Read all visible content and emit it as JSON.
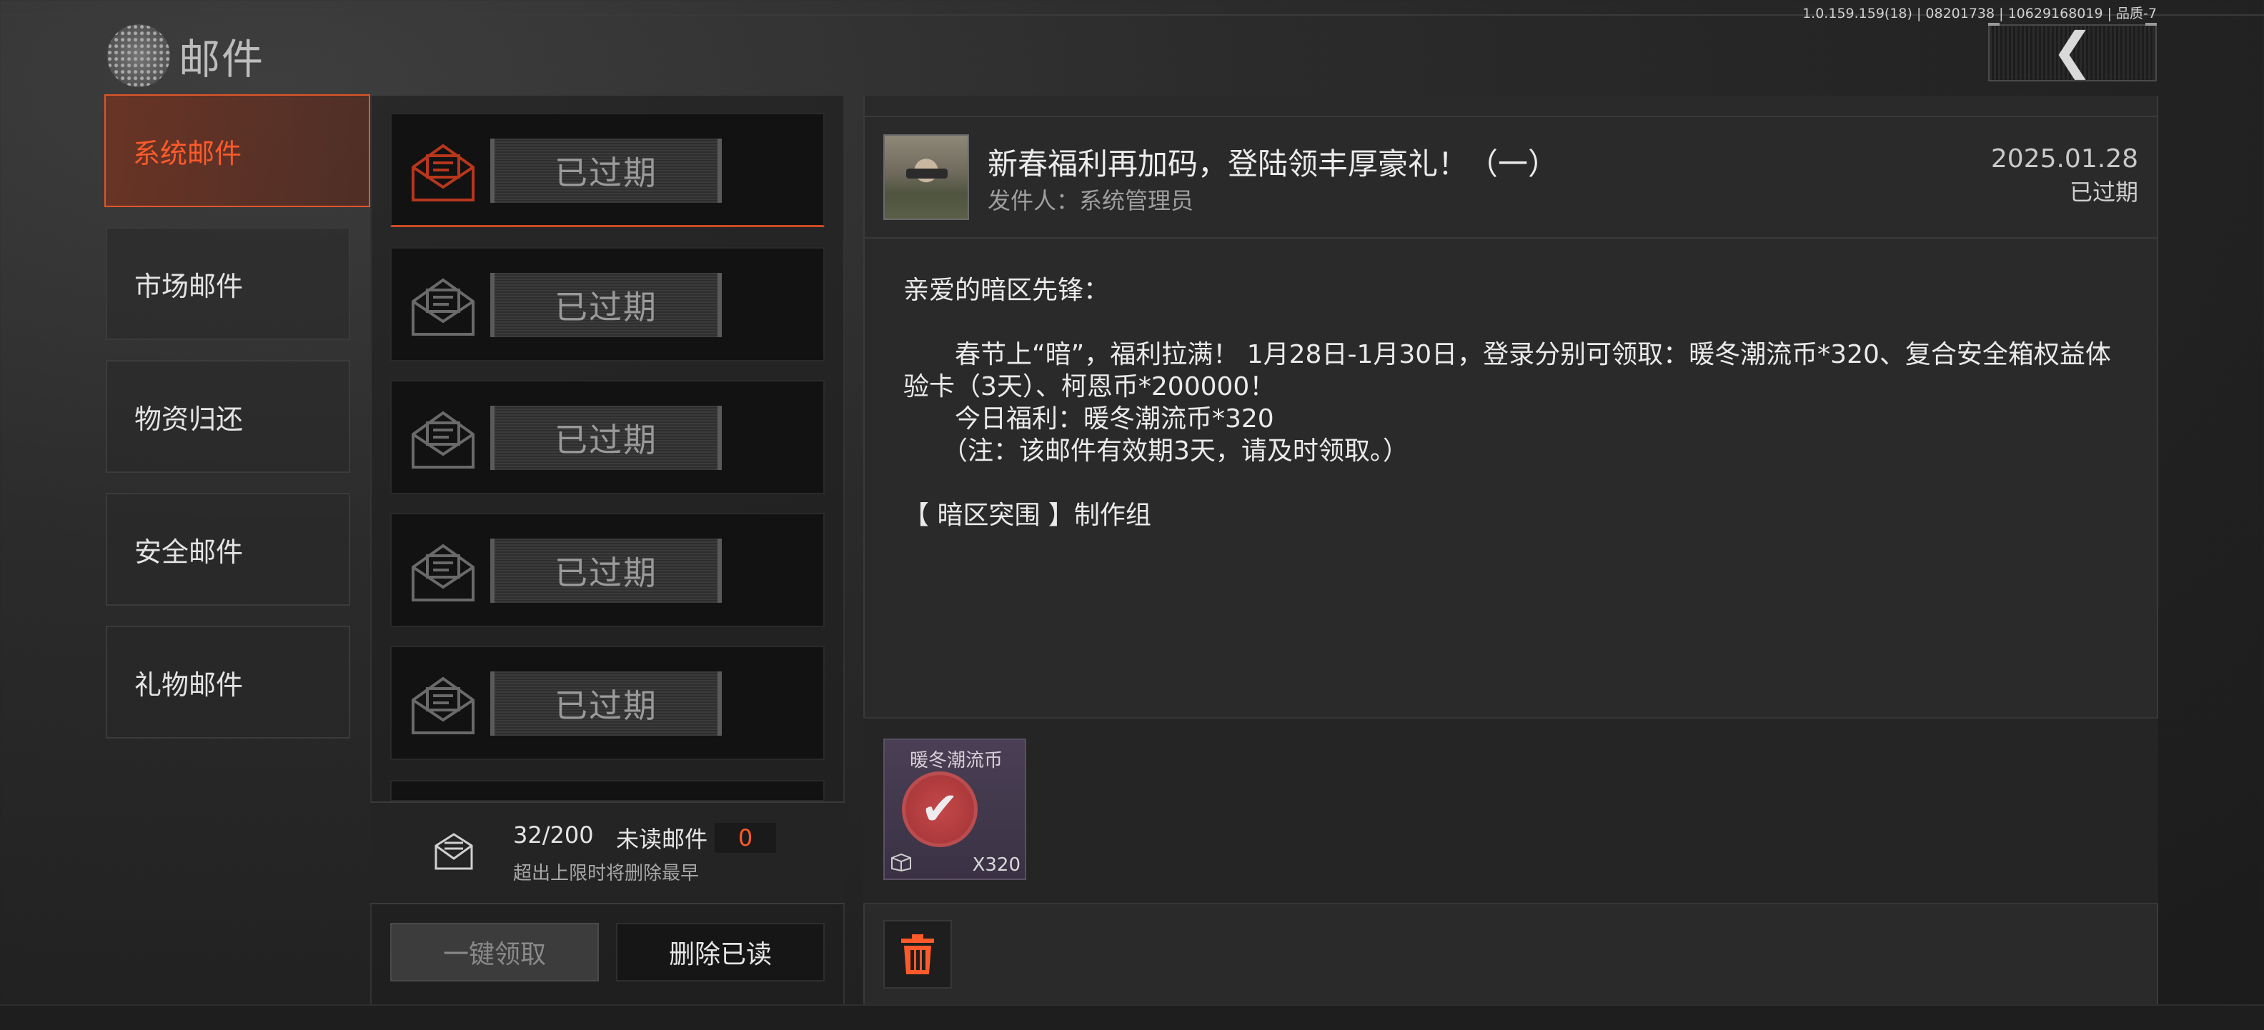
{
  "app": {
    "version_text": "1.0.159.159(18) | 08201738 | 10629168019 | 品质-7",
    "title": "邮件"
  },
  "categories": [
    {
      "label": "系统邮件",
      "active": true
    },
    {
      "label": "市场邮件",
      "active": false
    },
    {
      "label": "物资归还",
      "active": false
    },
    {
      "label": "安全邮件",
      "active": false
    },
    {
      "label": "礼物邮件",
      "active": false
    }
  ],
  "mail_list": {
    "items": [
      {
        "status": "已过期"
      },
      {
        "status": "已过期"
      },
      {
        "status": "已过期"
      },
      {
        "status": "已过期"
      },
      {
        "status": "已过期"
      }
    ],
    "count": "32/200",
    "unread_label": "未读邮件",
    "unread_count": "0",
    "limit_note": "超出上限时将删除最早",
    "claim_all_label": "一键领取",
    "delete_read_label": "删除已读"
  },
  "detail": {
    "title": "新春福利再加码，登陆领丰厚豪礼！（一）",
    "sender": "发件人：系统管理员",
    "date": "2025.01.28",
    "status": "已过期",
    "body": "亲爱的暗区先锋：\n\n　　春节上“暗”，福利拉满！ 1月28日-1月30日，登录分别可领取：暖冬潮流币*320、复合安全箱权益体验卡（3天）、柯恩币*200000！\n　　今日福利：暖冬潮流币*320\n　　（注：该邮件有效期3天，请及时领取。）\n\n【 暗区突围 】制作组",
    "attachment": {
      "name": "暖冬潮流币",
      "quantity": "X320"
    }
  },
  "colors": {
    "accent": "#ff5a2a",
    "active_bg": "#7a3420",
    "panel_bg": "#2a2a2a"
  },
  "icons": {
    "back": "chevron-left-icon",
    "mail": "open-envelope-icon",
    "inbox": "envelope-icon",
    "delete": "trash-icon",
    "claimed": "check-icon"
  }
}
